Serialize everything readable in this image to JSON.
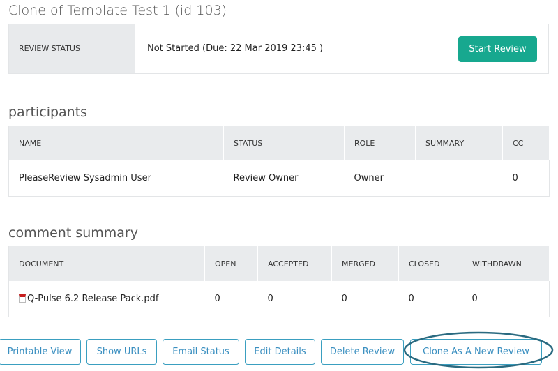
{
  "title": "Clone of Template Test 1  (id 103)",
  "review_status": {
    "label": "REVIEW STATUS",
    "value": "Not Started (Due: 22 Mar 2019 23:45 )",
    "button": "Start Review"
  },
  "participants": {
    "heading": "participants",
    "columns": [
      "NAME",
      "STATUS",
      "ROLE",
      "SUMMARY",
      "CC"
    ],
    "rows": [
      [
        "PleaseReview Sysadmin User",
        "Review Owner",
        "Owner",
        "",
        "0"
      ]
    ]
  },
  "comment_summary": {
    "heading": "comment summary",
    "columns": [
      "DOCUMENT",
      "OPEN",
      "ACCEPTED",
      "MERGED",
      "CLOSED",
      "WITHDRAWN"
    ],
    "rows": [
      [
        "Q-Pulse 6.2 Release Pack.pdf",
        "0",
        "0",
        "0",
        "0",
        "0"
      ]
    ]
  },
  "actions": [
    "Printable View",
    "Show URLs",
    "Email Status",
    "Edit Details",
    "Delete Review",
    "Clone As A New Review"
  ],
  "colors": {
    "accent": "#17a88f",
    "link": "#3a8fc0",
    "highlight": "#2a6a80"
  }
}
